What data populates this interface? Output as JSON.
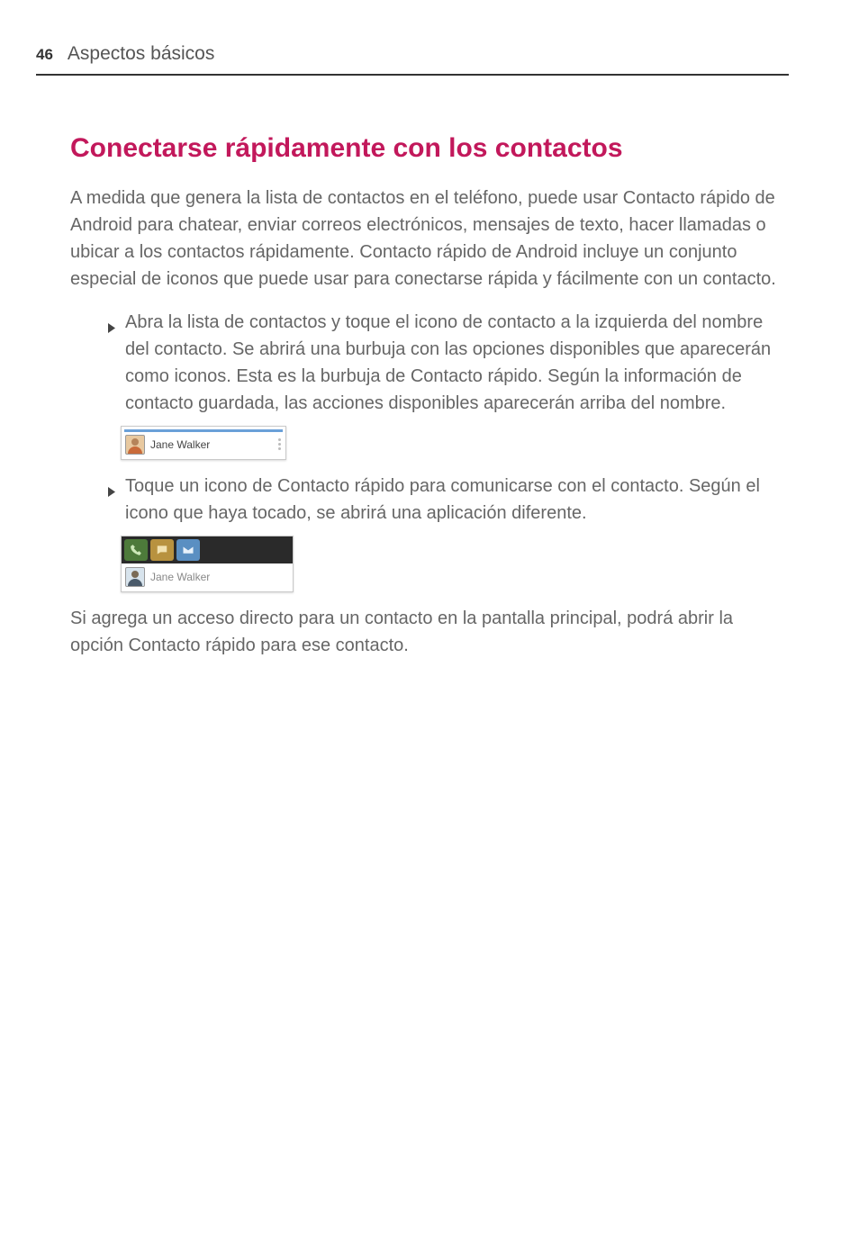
{
  "header": {
    "page_number": "46",
    "section": "Aspectos básicos"
  },
  "title": "Conectarse rápidamente con los contactos",
  "intro": "A medida que genera la lista de contactos en el teléfono, puede usar Contacto rápido de Android para chatear, enviar correos electrónicos, mensajes de texto, hacer llamadas o ubicar a los contactos rápidamente. Contacto rápido de Android incluye un conjunto especial de iconos que puede usar para conectarse rápida y fácilmente con un contacto.",
  "bullets": [
    "Abra la lista de contactos y toque el icono de contacto a la izquierda del nombre del contacto. Se abrirá una burbuja con las opciones disponibles que aparecerán como iconos. Esta es la burbuja de Contacto rápido. Según la información de contacto guardada, las acciones disponibles aparecerán arriba del nombre.",
    "Toque un icono de Contacto rápido para comunicarse con el contacto. Según el icono que haya tocado, se abrirá una aplicación diferente."
  ],
  "contact_name": "Jane Walker",
  "closing": "Si agrega un acceso directo para un contacto en la pantalla principal, podrá abrir la opción Contacto rápido para ese contacto."
}
